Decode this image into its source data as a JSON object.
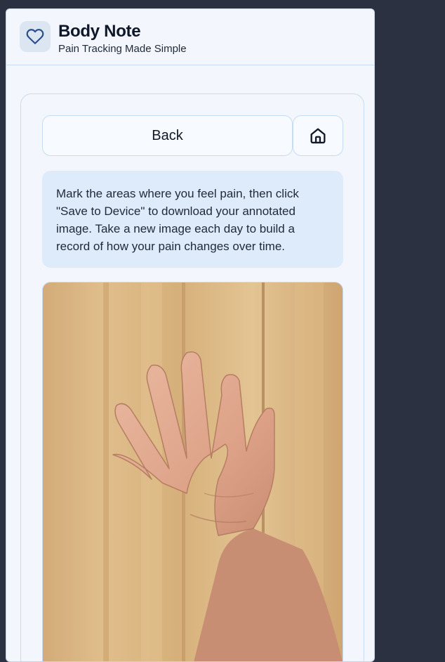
{
  "header": {
    "title": "Body Note",
    "subtitle": "Pain Tracking Made Simple",
    "logo_icon": "heart-icon"
  },
  "nav": {
    "back_label": "Back",
    "home_icon": "home-icon"
  },
  "instructions": {
    "text": "Mark the areas where you feel pain, then click \"Save to Device\" to download your annotated image. Take a new image each day to build a record of how your pain changes over time."
  },
  "photo": {
    "subject": "open-hand-on-wood"
  },
  "colors": {
    "accent": "#2b4f8c",
    "background": "#2c3142",
    "panel": "#f3f7fd",
    "info_bg": "#deebfb",
    "border": "#c7dcf3"
  }
}
